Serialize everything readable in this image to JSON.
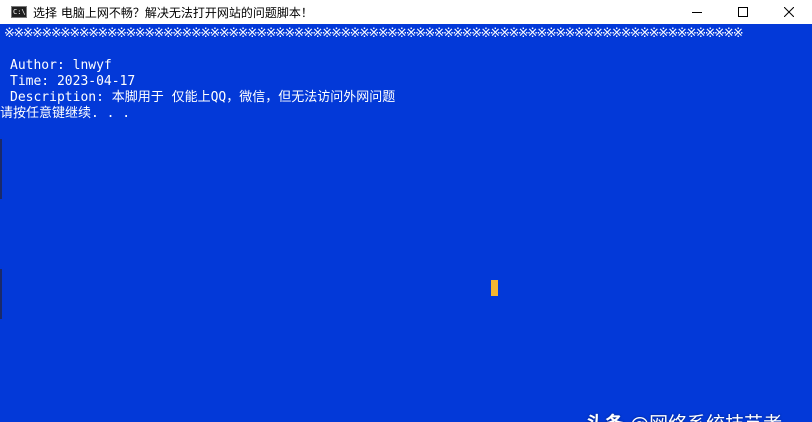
{
  "window": {
    "title": "选择 电脑上网不畅？解决无法打开网站的问题脚本！",
    "app_icon_text": "C:\\",
    "controls": [
      "minimize-icon",
      "maximize-icon",
      "close-icon"
    ]
  },
  "console": {
    "background_color": "#0339d8",
    "text_color": "#ffffff",
    "pattern_line": "※※※※※※※※※※※※※※※※※※※※※※※※※※※※※※※※※※※※※※※※※※※※※※※※※※※※※※※※※※※※※※※※※※※※※※※※※※※※※※※",
    "lines": [
      "Author: lnwyf",
      "Time: 2023-04-17",
      "Description: 本脚用于 仅能上QQ，微信，但无法访问外网问题",
      "请按任意键继续. . ."
    ],
    "cursor_color": "#f5b731"
  },
  "watermark": {
    "brand": "头条",
    "handle": "@网络系统技艺者"
  }
}
